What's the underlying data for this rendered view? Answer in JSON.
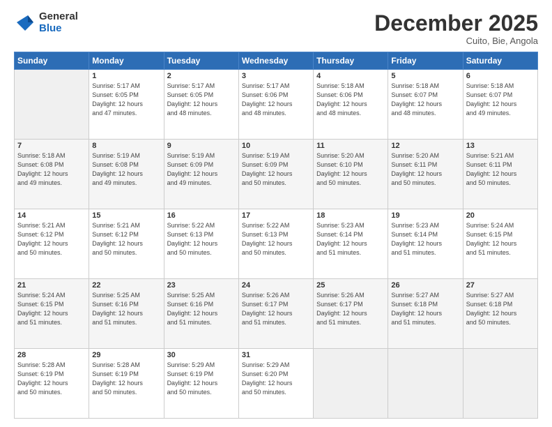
{
  "logo": {
    "general": "General",
    "blue": "Blue"
  },
  "header": {
    "month": "December 2025",
    "location": "Cuito, Bie, Angola"
  },
  "weekdays": [
    "Sunday",
    "Monday",
    "Tuesday",
    "Wednesday",
    "Thursday",
    "Friday",
    "Saturday"
  ],
  "weeks": [
    [
      {
        "day": "",
        "empty": true
      },
      {
        "day": "1",
        "sunrise": "5:17 AM",
        "sunset": "6:05 PM",
        "daylight": "12 hours and 47 minutes."
      },
      {
        "day": "2",
        "sunrise": "5:17 AM",
        "sunset": "6:05 PM",
        "daylight": "12 hours and 48 minutes."
      },
      {
        "day": "3",
        "sunrise": "5:17 AM",
        "sunset": "6:06 PM",
        "daylight": "12 hours and 48 minutes."
      },
      {
        "day": "4",
        "sunrise": "5:18 AM",
        "sunset": "6:06 PM",
        "daylight": "12 hours and 48 minutes."
      },
      {
        "day": "5",
        "sunrise": "5:18 AM",
        "sunset": "6:07 PM",
        "daylight": "12 hours and 48 minutes."
      },
      {
        "day": "6",
        "sunrise": "5:18 AM",
        "sunset": "6:07 PM",
        "daylight": "12 hours and 49 minutes."
      }
    ],
    [
      {
        "day": "7",
        "sunrise": "5:18 AM",
        "sunset": "6:08 PM",
        "daylight": "12 hours and 49 minutes."
      },
      {
        "day": "8",
        "sunrise": "5:19 AM",
        "sunset": "6:08 PM",
        "daylight": "12 hours and 49 minutes."
      },
      {
        "day": "9",
        "sunrise": "5:19 AM",
        "sunset": "6:09 PM",
        "daylight": "12 hours and 49 minutes."
      },
      {
        "day": "10",
        "sunrise": "5:19 AM",
        "sunset": "6:09 PM",
        "daylight": "12 hours and 50 minutes."
      },
      {
        "day": "11",
        "sunrise": "5:20 AM",
        "sunset": "6:10 PM",
        "daylight": "12 hours and 50 minutes."
      },
      {
        "day": "12",
        "sunrise": "5:20 AM",
        "sunset": "6:11 PM",
        "daylight": "12 hours and 50 minutes."
      },
      {
        "day": "13",
        "sunrise": "5:21 AM",
        "sunset": "6:11 PM",
        "daylight": "12 hours and 50 minutes."
      }
    ],
    [
      {
        "day": "14",
        "sunrise": "5:21 AM",
        "sunset": "6:12 PM",
        "daylight": "12 hours and 50 minutes."
      },
      {
        "day": "15",
        "sunrise": "5:21 AM",
        "sunset": "6:12 PM",
        "daylight": "12 hours and 50 minutes."
      },
      {
        "day": "16",
        "sunrise": "5:22 AM",
        "sunset": "6:13 PM",
        "daylight": "12 hours and 50 minutes."
      },
      {
        "day": "17",
        "sunrise": "5:22 AM",
        "sunset": "6:13 PM",
        "daylight": "12 hours and 50 minutes."
      },
      {
        "day": "18",
        "sunrise": "5:23 AM",
        "sunset": "6:14 PM",
        "daylight": "12 hours and 51 minutes."
      },
      {
        "day": "19",
        "sunrise": "5:23 AM",
        "sunset": "6:14 PM",
        "daylight": "12 hours and 51 minutes."
      },
      {
        "day": "20",
        "sunrise": "5:24 AM",
        "sunset": "6:15 PM",
        "daylight": "12 hours and 51 minutes."
      }
    ],
    [
      {
        "day": "21",
        "sunrise": "5:24 AM",
        "sunset": "6:15 PM",
        "daylight": "12 hours and 51 minutes."
      },
      {
        "day": "22",
        "sunrise": "5:25 AM",
        "sunset": "6:16 PM",
        "daylight": "12 hours and 51 minutes."
      },
      {
        "day": "23",
        "sunrise": "5:25 AM",
        "sunset": "6:16 PM",
        "daylight": "12 hours and 51 minutes."
      },
      {
        "day": "24",
        "sunrise": "5:26 AM",
        "sunset": "6:17 PM",
        "daylight": "12 hours and 51 minutes."
      },
      {
        "day": "25",
        "sunrise": "5:26 AM",
        "sunset": "6:17 PM",
        "daylight": "12 hours and 51 minutes."
      },
      {
        "day": "26",
        "sunrise": "5:27 AM",
        "sunset": "6:18 PM",
        "daylight": "12 hours and 51 minutes."
      },
      {
        "day": "27",
        "sunrise": "5:27 AM",
        "sunset": "6:18 PM",
        "daylight": "12 hours and 50 minutes."
      }
    ],
    [
      {
        "day": "28",
        "sunrise": "5:28 AM",
        "sunset": "6:19 PM",
        "daylight": "12 hours and 50 minutes."
      },
      {
        "day": "29",
        "sunrise": "5:28 AM",
        "sunset": "6:19 PM",
        "daylight": "12 hours and 50 minutes."
      },
      {
        "day": "30",
        "sunrise": "5:29 AM",
        "sunset": "6:19 PM",
        "daylight": "12 hours and 50 minutes."
      },
      {
        "day": "31",
        "sunrise": "5:29 AM",
        "sunset": "6:20 PM",
        "daylight": "12 hours and 50 minutes."
      },
      {
        "day": "",
        "empty": true
      },
      {
        "day": "",
        "empty": true
      },
      {
        "day": "",
        "empty": true
      }
    ]
  ]
}
